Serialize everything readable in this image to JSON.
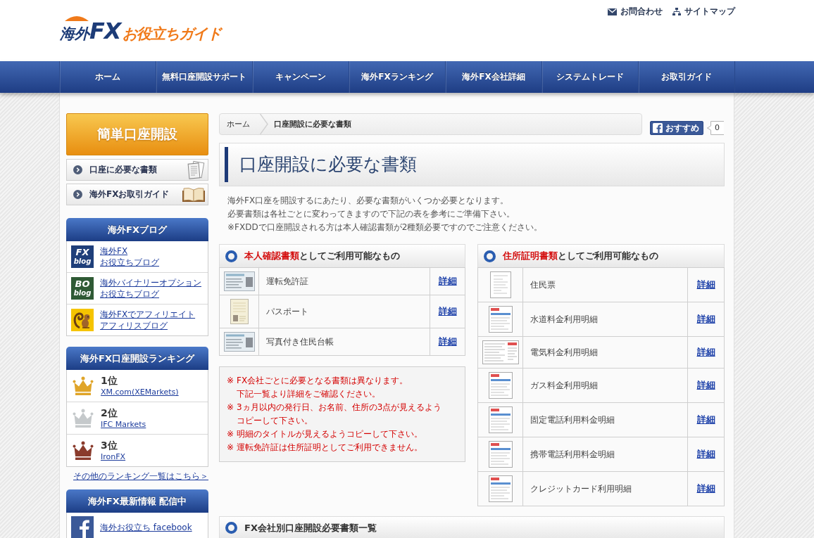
{
  "header": {
    "logo": {
      "prefix": "海外",
      "brand": "FX",
      "suffix": "お役立ちガイド"
    },
    "top_links": [
      {
        "kind": "mail",
        "label": "お問合わせ"
      },
      {
        "kind": "sitemap",
        "label": "サイトマップ"
      }
    ]
  },
  "nav": [
    "ホーム",
    "無料口座開設サポート",
    "キャンペーン",
    "海外FXランキング",
    "海外FX会社詳細",
    "システムトレード",
    "お取引ガイド"
  ],
  "sidebar": {
    "cta": "簡単口座開設",
    "menu": [
      {
        "kind": "documents",
        "label": "口座に必要な書類"
      },
      {
        "kind": "book",
        "label": "海外FXお取引ガイド"
      }
    ],
    "blog": {
      "title": "海外FXブログ",
      "items": [
        {
          "kind": "tile",
          "color": "#1f3f7a",
          "badge": [
            "FX",
            "blog"
          ],
          "lines": [
            "海外FX",
            "お役立ちブログ"
          ]
        },
        {
          "kind": "tile",
          "color": "#2f5a35",
          "badge": [
            "BO",
            "blog"
          ],
          "lines": [
            "海外バイナリーオプション",
            "お役立ちブログ"
          ]
        },
        {
          "kind": "squirrel",
          "lines": [
            "海外FXでアフィリエイト",
            "アフィリスブログ"
          ]
        }
      ]
    },
    "ranking": {
      "title": "海外FX口座開設ランキング",
      "items": [
        {
          "rank": "1位",
          "name": "XM.com(XEMarkets)",
          "color": "#e0a52a"
        },
        {
          "rank": "2位",
          "name": "IFC Markets",
          "color": "#c5c9cb"
        },
        {
          "rank": "3位",
          "name": "IronFX",
          "color": "#8a3b2c"
        }
      ],
      "more": "その他のランキング一覧はこちら＞"
    },
    "news": {
      "title": "海外FX最新情報 配信中",
      "items": [
        {
          "kind": "facebook",
          "label": "海外お役立ち facebook"
        }
      ]
    }
  },
  "main": {
    "breadcrumb": [
      {
        "label": "ホーム",
        "current": false
      },
      {
        "label": "口座開設に必要な書類",
        "current": true
      }
    ],
    "share": {
      "label": "おすすめ",
      "count": "0"
    },
    "title": "口座開設に必要な書類",
    "intro": [
      "海外FX口座を開設するにあたり、必要な書類がいくつか必要となります。",
      "必要書類は各社ごとに変わってきますので下記の表を参考にご準備下さい。",
      "※FXDDで口座開設される方は本人確認書類が2種類必要ですのでご注意ください。"
    ],
    "panels": [
      {
        "title_emphasis": "本人確認書類",
        "title_rest": "としてご利用可能なもの",
        "rows": [
          {
            "kind": "card",
            "name": "運転免許証",
            "link": "詳細"
          },
          {
            "kind": "booklet",
            "name": "パスポート",
            "link": "詳細"
          },
          {
            "kind": "card",
            "name": "写真付き住民台帳",
            "link": "詳細"
          }
        ]
      },
      {
        "title_emphasis": "住所証明書類",
        "title_rest": "としてご利用可能なもの",
        "rows": [
          {
            "kind": "document",
            "name": "住民票",
            "link": "詳細"
          },
          {
            "kind": "bill",
            "name": "水道料金利用明細",
            "link": "詳細"
          },
          {
            "kind": "wide_bill",
            "name": "電気料金利用明細",
            "link": "詳細"
          },
          {
            "kind": "bill",
            "name": "ガス料金利用明細",
            "link": "詳細"
          },
          {
            "kind": "bill",
            "name": "固定電話利用料金明細",
            "link": "詳細"
          },
          {
            "kind": "bill",
            "name": "携帯電話利用料金明細",
            "link": "詳細"
          },
          {
            "kind": "bill",
            "name": "クレジットカード利用明細",
            "link": "詳細"
          }
        ]
      }
    ],
    "notes": [
      {
        "mark": "※",
        "lines": [
          "FX会社ごとに必要となる書類は異なります。",
          "下記一覧より詳細をご確認ください。"
        ]
      },
      {
        "mark": "※",
        "lines": [
          "3ヵ月以内の発行日、お名前、住所の3点が見えるよう",
          "コピーして下さい。"
        ]
      },
      {
        "mark": "※",
        "lines": [
          "明細のタイトルが見えるようコピーして下さい。"
        ]
      },
      {
        "mark": "※",
        "lines": [
          "運転免許証は住所証明としてご利用できません。"
        ]
      }
    ],
    "list_title": "FX会社別口座開設必要書類一覧"
  }
}
